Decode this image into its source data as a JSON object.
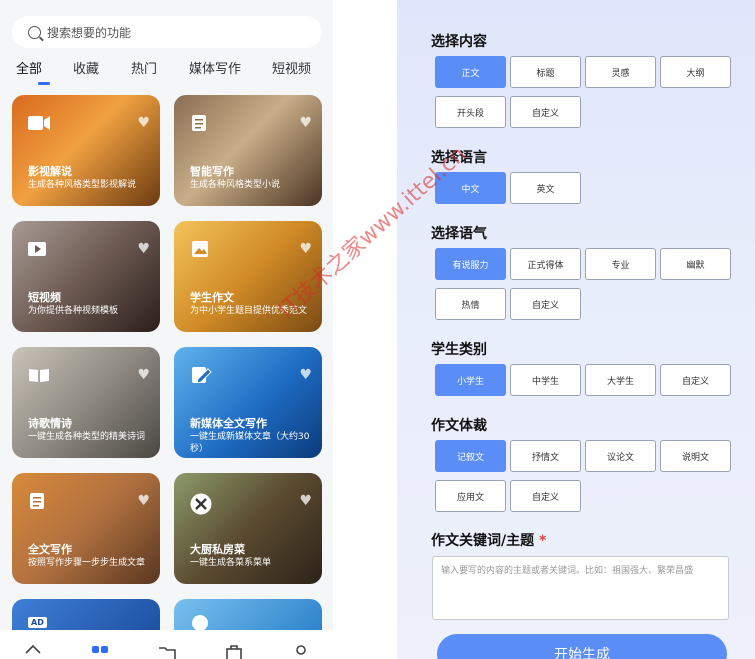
{
  "search": {
    "placeholder": "搜索想要的功能"
  },
  "tabs": [
    "全部",
    "收藏",
    "热门",
    "媒体写作",
    "短视频"
  ],
  "cards": [
    {
      "title": "影视解说",
      "desc": "生成各种风格类型影视解说",
      "icon": "video-camera-icon"
    },
    {
      "title": "智能写作",
      "desc": "生成各种风格类型小说",
      "icon": "document-list-icon"
    },
    {
      "title": "短视频",
      "desc": "为你提供各种视频模板",
      "icon": "play-video-icon"
    },
    {
      "title": "学生作文",
      "desc": "为中小学生题目提供优秀范文",
      "icon": "picture-icon"
    },
    {
      "title": "诗歌情诗",
      "desc": "一键生成各种类型的精美诗词",
      "icon": "open-book-icon"
    },
    {
      "title": "新媒体全文写作",
      "desc": "一键生成新媒体文章（大约30秒）",
      "icon": "edit-note-icon"
    },
    {
      "title": "全文写作",
      "desc": "按照写作步骤一步步生成文章",
      "icon": "document-list-icon"
    },
    {
      "title": "大厨私房菜",
      "desc": "一键生成各菜系菜单",
      "icon": "utensils-icon"
    }
  ],
  "partial_cards": [
    {
      "badge": "AD"
    }
  ],
  "sections": {
    "content": {
      "title": "选择内容",
      "options": [
        "正文",
        "标题",
        "灵感",
        "大纲",
        "开头段",
        "自定义"
      ],
      "selected": "正文"
    },
    "language": {
      "title": "选择语言",
      "options": [
        "中文",
        "英文"
      ],
      "selected": "中文"
    },
    "tone": {
      "title": "选择语气",
      "options": [
        "有说服力",
        "正式得体",
        "专业",
        "幽默",
        "热情",
        "自定义"
      ],
      "selected": "有说服力"
    },
    "student": {
      "title": "学生类别",
      "options": [
        "小学生",
        "中学生",
        "大学生",
        "自定义"
      ],
      "selected": "小学生"
    },
    "genre": {
      "title": "作文体裁",
      "options": [
        "记叙文",
        "抒情文",
        "议论文",
        "说明文",
        "应用文",
        "自定义"
      ],
      "selected": "记叙文"
    },
    "keywords": {
      "title": "作文关键词/主题",
      "required_mark": "*",
      "placeholder": "输入要写的内容的主题或者关键词。比如：祖国强大、繁荣昌盛"
    }
  },
  "start_button": "开始生成",
  "watermark": "IT技术之家www.ittel.cn",
  "colors": {
    "accent": "#5a8df6",
    "tab_indicator": "#2f6bf5",
    "required": "#e0433b"
  }
}
